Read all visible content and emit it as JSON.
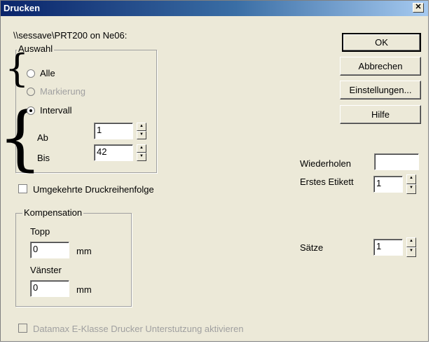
{
  "window": {
    "title": "Drucken",
    "close_label": "✕"
  },
  "printer": {
    "path": "\\\\sessave\\PRT200 on Ne06:"
  },
  "buttons": {
    "ok": "OK",
    "cancel": "Abbrechen",
    "settings": "Einstellungen...",
    "help": "Hilfe"
  },
  "auswahl": {
    "label": "Auswahl",
    "options": [
      {
        "label": "Alle",
        "selected": false,
        "enabled": true
      },
      {
        "label": "Markierung",
        "selected": false,
        "enabled": false
      },
      {
        "label": "Intervall",
        "selected": true,
        "enabled": true
      }
    ],
    "from_label": "Ab",
    "from_value": "1",
    "to_label": "Bis",
    "to_value": "42"
  },
  "reverse_order": {
    "label": "Umgekehrte Druckreihenfolge",
    "checked": false
  },
  "kompensation": {
    "label": "Kompensation",
    "top_label": "Topp",
    "top_value": "0",
    "top_unit": "mm",
    "left_label": "Vänster",
    "left_value": "0",
    "left_unit": "mm"
  },
  "right_panel": {
    "repeat_label": "Wiederholen",
    "repeat_value": "",
    "first_label_label": "Erstes Etikett",
    "first_label_value": "1",
    "sets_label": "Sätze",
    "sets_value": "1"
  },
  "datamax": {
    "label": "Datamax E-Klasse Drucker Unterstutzung aktivieren",
    "checked": false,
    "enabled": false
  },
  "colors": {
    "dialog_bg": "#ece9d8",
    "title_start": "#0a246a",
    "title_end": "#a6caf0",
    "disabled_text": "#a0a0a0"
  }
}
